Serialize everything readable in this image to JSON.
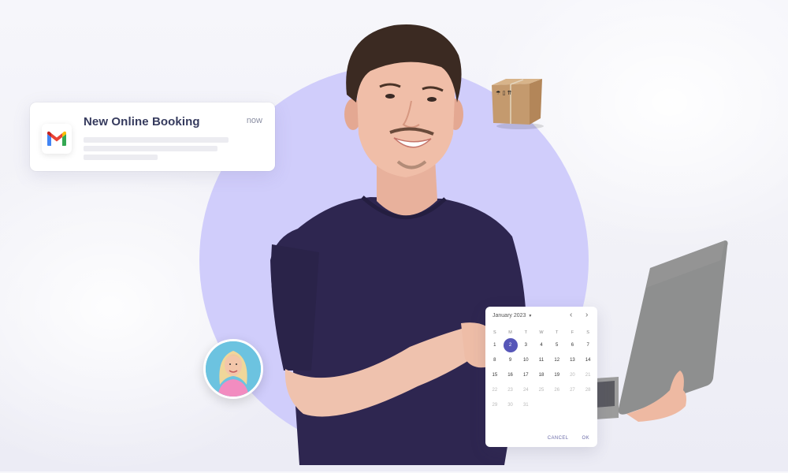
{
  "notification": {
    "app_icon": "gmail-icon",
    "title": "New Online Booking",
    "time": "now"
  },
  "calendar": {
    "month_label": "January 2023",
    "prev_icon": "chevron-left-icon",
    "next_icon": "chevron-right-icon",
    "weekdays": [
      "S",
      "M",
      "T",
      "W",
      "T",
      "F",
      "S"
    ],
    "selected_day": 2,
    "days": [
      {
        "d": "1",
        "muted": false
      },
      {
        "d": "2",
        "muted": false
      },
      {
        "d": "3",
        "muted": false
      },
      {
        "d": "4",
        "muted": false
      },
      {
        "d": "5",
        "muted": false
      },
      {
        "d": "6",
        "muted": false
      },
      {
        "d": "7",
        "muted": false
      },
      {
        "d": "8",
        "muted": false
      },
      {
        "d": "9",
        "muted": false
      },
      {
        "d": "10",
        "muted": false
      },
      {
        "d": "11",
        "muted": false
      },
      {
        "d": "12",
        "muted": false
      },
      {
        "d": "13",
        "muted": false
      },
      {
        "d": "14",
        "muted": false
      },
      {
        "d": "15",
        "muted": false
      },
      {
        "d": "16",
        "muted": false
      },
      {
        "d": "17",
        "muted": false
      },
      {
        "d": "18",
        "muted": false
      },
      {
        "d": "19",
        "muted": false
      },
      {
        "d": "20",
        "muted": true
      },
      {
        "d": "21",
        "muted": true
      },
      {
        "d": "22",
        "muted": true
      },
      {
        "d": "23",
        "muted": true
      },
      {
        "d": "24",
        "muted": true
      },
      {
        "d": "25",
        "muted": true
      },
      {
        "d": "26",
        "muted": true
      },
      {
        "d": "27",
        "muted": true
      },
      {
        "d": "28",
        "muted": true
      },
      {
        "d": "29",
        "muted": true
      },
      {
        "d": "30",
        "muted": true
      },
      {
        "d": "31",
        "muted": true
      }
    ],
    "cancel_label": "CANCEL",
    "ok_label": "OK"
  },
  "colors": {
    "circle": "#d0cdfb",
    "accent": "#5656b8",
    "title_text": "#363b5e",
    "shirt": "#2e2650"
  }
}
